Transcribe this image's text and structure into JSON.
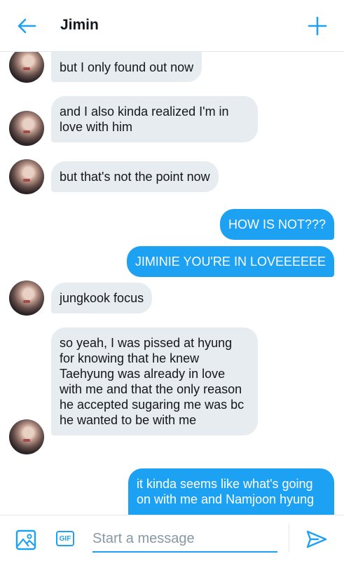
{
  "header": {
    "title": "Jimin",
    "back_icon": "arrow-left-icon",
    "plus_icon": "plus-icon",
    "accent": "#1da1f2"
  },
  "messages": [
    {
      "side": "in",
      "text": "but I only found out now"
    },
    {
      "side": "in",
      "text": "and I also kinda realized I'm in love with him"
    },
    {
      "side": "in",
      "text": "but that's not the point now"
    },
    {
      "side": "out",
      "text": "HOW IS NOT???"
    },
    {
      "side": "out",
      "text": "JIMINIE YOU'RE IN LOVEEEEEE"
    },
    {
      "side": "in",
      "text": "jungkook focus"
    },
    {
      "side": "in",
      "text": "so yeah, I was pissed at hyung for knowing that he knew Taehyung was already in love with me and that the only reason he accepted sugaring me was bc he wanted to be with me"
    },
    {
      "side": "out",
      "text": "it kinda seems like what's going on with me and Namjoon hyung"
    }
  ],
  "composer": {
    "placeholder": "Start a message",
    "gif_label": "GIF",
    "image_icon": "image-icon",
    "send_icon": "send-icon"
  },
  "colors": {
    "incoming_bubble": "#e6ecf0",
    "outgoing_bubble": "#1da1f2"
  }
}
